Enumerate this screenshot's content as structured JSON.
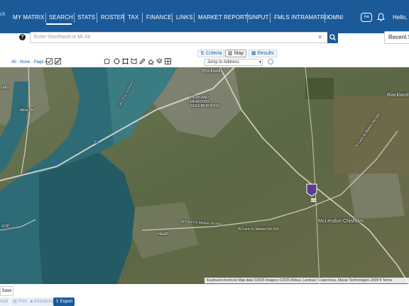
{
  "nav": {
    "items": [
      "MY MATRIX",
      "SEARCH",
      "STATS",
      "ROSTER",
      "TAX",
      "FINANCE",
      "LINKS",
      "MARKET REPORTS",
      "INPUT",
      "FMLS INTRAMATRIX",
      "OMNI"
    ],
    "active": "SEARCH",
    "aa_label": "Aa",
    "greeting": "Hello, I",
    "logo_text": "ch"
  },
  "search": {
    "placeholder": "Enter Shorthand or MLS#",
    "clear_label": "×",
    "recent_label": "Recent S"
  },
  "views": {
    "criteria": "Criteria",
    "map": "Map",
    "results": "Results",
    "active": "Map"
  },
  "selection": {
    "all": "All",
    "none": "None",
    "page": "Page"
  },
  "map_tools": {
    "jump_label": "Jump to Address",
    "icons": [
      "polygon-draw-icon",
      "circle-draw-icon",
      "square-draw-icon",
      "freehand-draw-icon",
      "pencil-icon",
      "erase-icon",
      "layers-icon",
      "parcels-icon"
    ]
  },
  "map": {
    "labels": {
      "rockwall": "Rockwall",
      "highland_meadows": "HIGHLAND\nMEADOWS\nNEIGHBORHOOD",
      "lake_ray_hubbard": "Lake Ray Hubbard",
      "blackland": "Blackland",
      "mclendon_chisholm": "McLendon-Chisholm",
      "heath": "Heath",
      "fm550_a": "W Farm to Market Rd 550",
      "fm550_b": "W Farm to Market Rd 550",
      "fm550_c": "E Farm to Market Rd 550",
      "ratin": "ratin",
      "miller_rd": "Miller Rd",
      "ase": "ASE"
    },
    "route_30": "30",
    "route_205": "205",
    "marker_color": "#5b3e8c",
    "attribution": "Keyboard shortcuts   Map data ©2025 Imagery ©2025 Airbus, Landsat / Copernicus, Maxar Technologies   2000 ft   Terms"
  },
  "actions": {
    "save": "Save",
    "email": "mail",
    "print": "Print",
    "directions": "Directions",
    "export": "Export"
  },
  "colors": {
    "brand": "#1b5a99",
    "water": "#2d6b76",
    "land": "#5a6a44"
  }
}
